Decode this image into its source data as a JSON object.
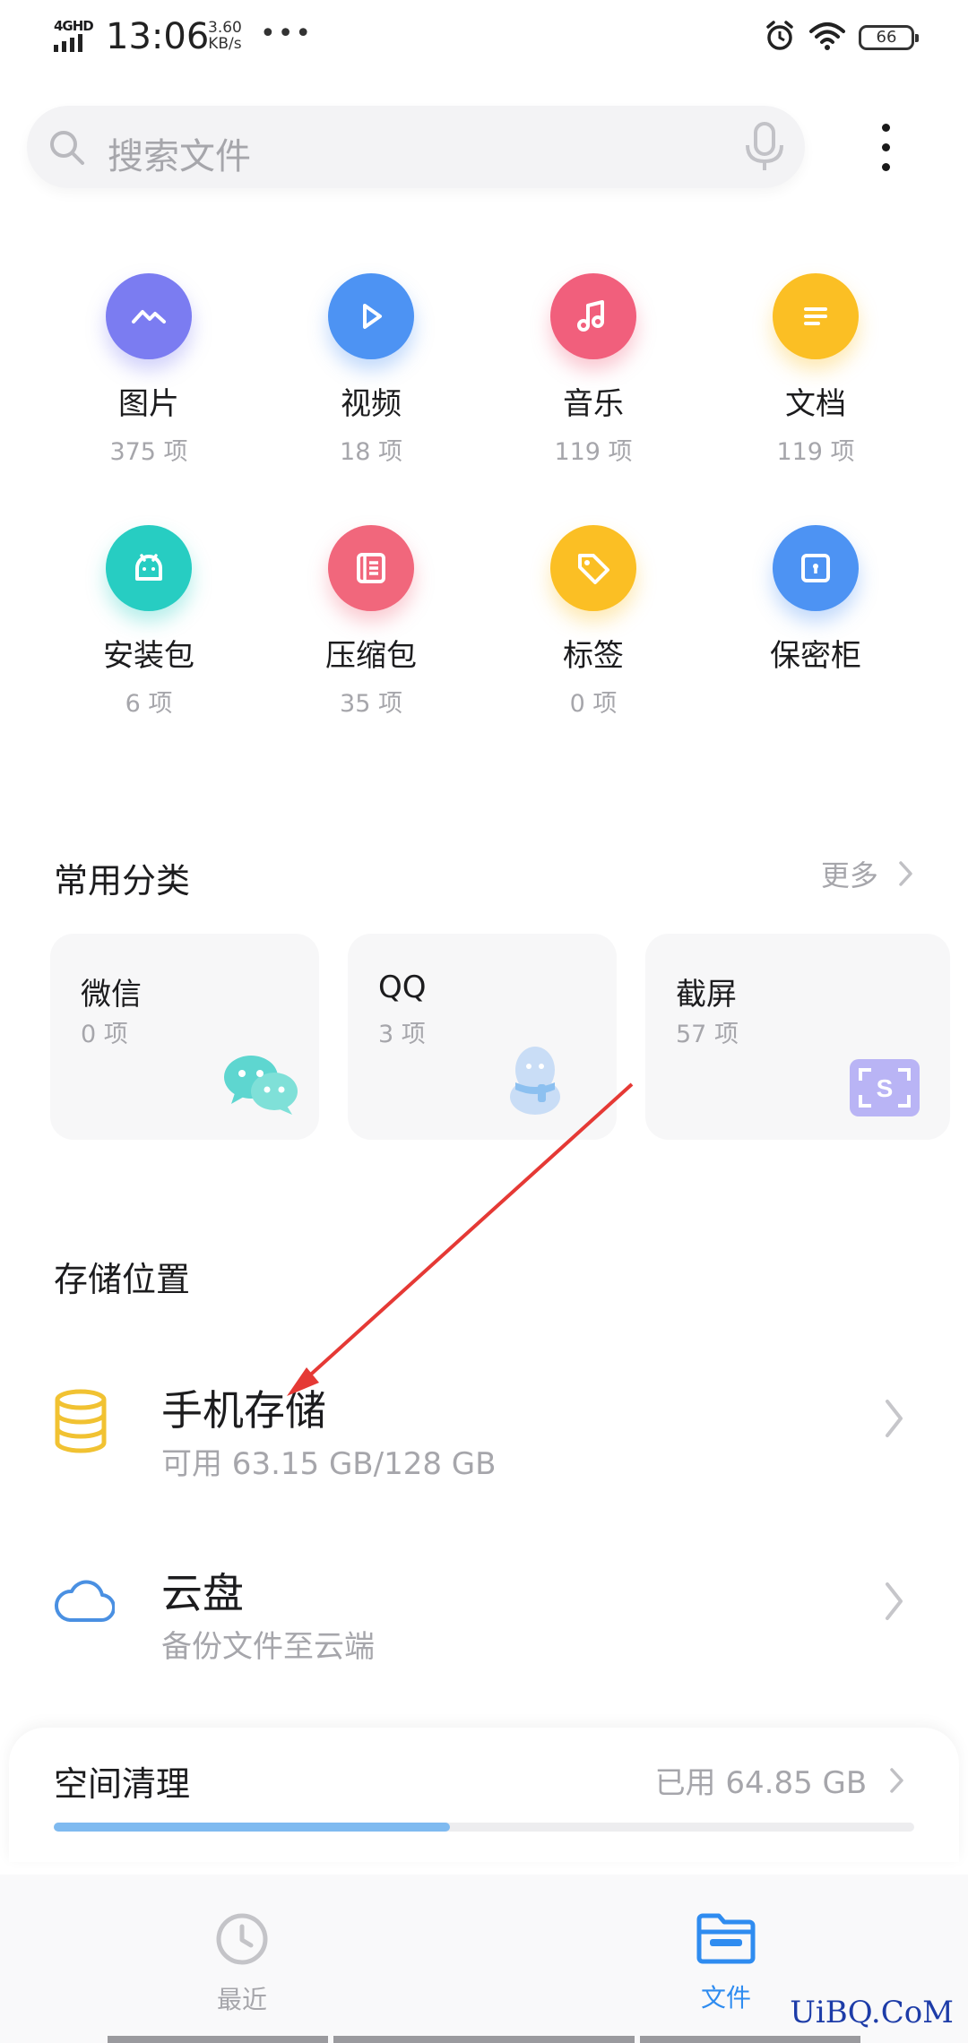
{
  "status_bar": {
    "network": "4GHD",
    "time": "13:06",
    "speed_value": "3.60",
    "speed_unit": "KB/s",
    "dots": "•••",
    "battery": "66"
  },
  "search": {
    "placeholder": "搜索文件"
  },
  "categories": [
    {
      "name": "图片",
      "count": "375 项",
      "color": "#7b7cf1",
      "icon": "image-icon"
    },
    {
      "name": "视频",
      "count": "18 项",
      "color": "#4d93f3",
      "icon": "play-icon"
    },
    {
      "name": "音乐",
      "count": "119 项",
      "color": "#f15f7c",
      "icon": "music-icon"
    },
    {
      "name": "文档",
      "count": "119 项",
      "color": "#fbbf24",
      "icon": "document-icon"
    },
    {
      "name": "安装包",
      "count": "6 项",
      "color": "#27cdc2",
      "icon": "android-icon"
    },
    {
      "name": "压缩包",
      "count": "35 项",
      "color": "#f1677c",
      "icon": "archive-icon"
    },
    {
      "name": "标签",
      "count": "0 项",
      "color": "#fbbf24",
      "icon": "tag-icon"
    },
    {
      "name": "保密柜",
      "count": "",
      "color": "#4d93f3",
      "icon": "safe-icon"
    }
  ],
  "common": {
    "title": "常用分类",
    "more": "更多",
    "cards": [
      {
        "name": "微信",
        "count": "0 项",
        "icon": "wechat-icon"
      },
      {
        "name": "QQ",
        "count": "3 项",
        "icon": "qq-icon"
      },
      {
        "name": "截屏",
        "count": "57 项",
        "icon": "screenshot-icon"
      }
    ]
  },
  "storage": {
    "title": "存储位置",
    "items": [
      {
        "title": "手机存储",
        "subtitle": "可用 63.15 GB/128 GB",
        "icon": "database-icon"
      },
      {
        "title": "云盘",
        "subtitle": "备份文件至云端",
        "icon": "cloud-icon"
      }
    ]
  },
  "space": {
    "title": "空间清理",
    "used": "已用 64.85 GB",
    "progress_percent": 46
  },
  "nav": {
    "items": [
      {
        "label": "最近",
        "active": false
      },
      {
        "label": "文件",
        "active": true
      }
    ]
  },
  "watermark": "UiBQ.CoM",
  "colors": {
    "accent": "#2f8cf0",
    "annotation": "#e53935"
  }
}
